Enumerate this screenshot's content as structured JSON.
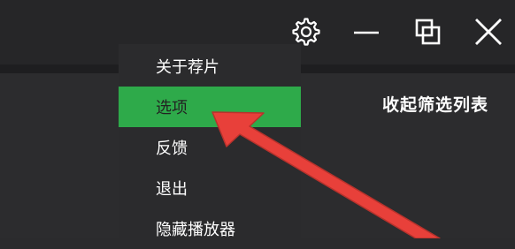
{
  "window_controls": {
    "settings_icon": "gear-icon",
    "minimize_icon": "minimize-icon",
    "restore_icon": "restore-icon",
    "close_icon": "close-icon"
  },
  "main": {
    "collapse_filter_label": "收起筛选列表"
  },
  "menu": {
    "items": [
      {
        "label": "关于荐片",
        "highlighted": false
      },
      {
        "label": "选项",
        "highlighted": true
      },
      {
        "label": "反馈",
        "highlighted": false
      },
      {
        "label": "退出",
        "highlighted": false
      },
      {
        "label": "隐藏播放器",
        "highlighted": false
      }
    ]
  },
  "colors": {
    "background": "#2b2b2d",
    "highlight": "#2eaa4a",
    "annotation_arrow": "#e8403a"
  }
}
